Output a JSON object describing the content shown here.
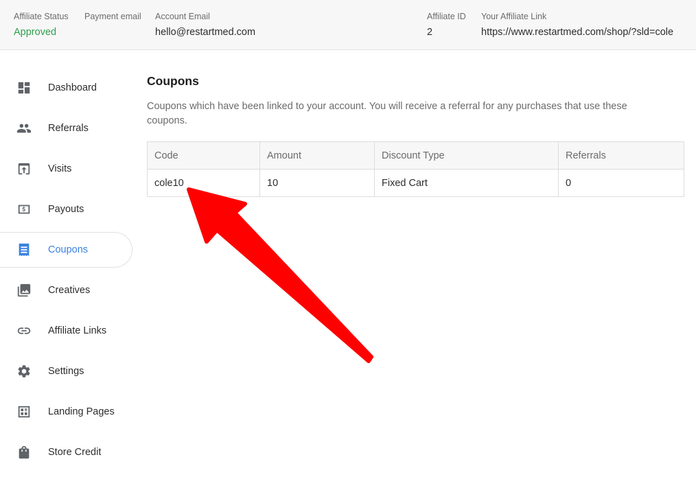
{
  "header": {
    "affiliate_status": {
      "label": "Affiliate Status",
      "value": "Approved"
    },
    "payment_email": {
      "label": "Payment email"
    },
    "account_email": {
      "label": "Account Email",
      "value": "hello@restartmed.com"
    },
    "affiliate_id": {
      "label": "Affiliate ID",
      "value": "2"
    },
    "affiliate_link": {
      "label": "Your Affiliate Link",
      "value": "https://www.restartmed.com/shop/?sld=cole"
    }
  },
  "sidebar": {
    "items": [
      {
        "label": "Dashboard",
        "icon": "dashboard-icon",
        "active": false
      },
      {
        "label": "Referrals",
        "icon": "people-icon",
        "active": false
      },
      {
        "label": "Visits",
        "icon": "visits-icon",
        "active": false
      },
      {
        "label": "Payouts",
        "icon": "dollar-icon",
        "active": false
      },
      {
        "label": "Coupons",
        "icon": "coupon-icon",
        "active": true
      },
      {
        "label": "Creatives",
        "icon": "image-library-icon",
        "active": false
      },
      {
        "label": "Affiliate Links",
        "icon": "link-icon",
        "active": false
      },
      {
        "label": "Settings",
        "icon": "gear-icon",
        "active": false
      },
      {
        "label": "Landing Pages",
        "icon": "landing-page-icon",
        "active": false
      },
      {
        "label": "Store Credit",
        "icon": "shopping-bag-icon",
        "active": false
      }
    ]
  },
  "main": {
    "title": "Coupons",
    "description": "Coupons which have been linked to your account. You will receive a referral for any purchases that use these coupons.",
    "table": {
      "columns": [
        "Code",
        "Amount",
        "Discount Type",
        "Referrals"
      ],
      "rows": [
        [
          "cole10",
          "10",
          "Fixed Cart",
          "0"
        ]
      ]
    }
  },
  "colors": {
    "accent": "#3b82e0",
    "status_approved": "#2e9e4a",
    "annotation_arrow": "#ff0000"
  }
}
